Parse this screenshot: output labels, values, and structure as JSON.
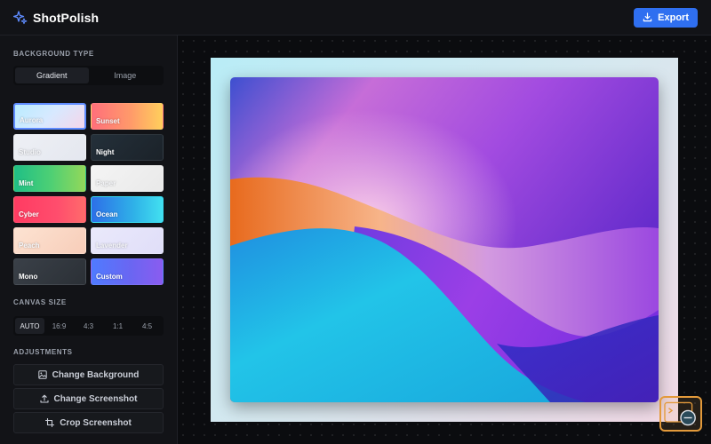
{
  "header": {
    "app_name": "ShotPolish",
    "export_label": "Export"
  },
  "sidebar": {
    "background_type_label": "BACKGROUND TYPE",
    "background_types": [
      {
        "label": "Gradient",
        "active": true
      },
      {
        "label": "Image",
        "active": false
      }
    ],
    "presets": [
      {
        "label": "Aurora",
        "selected": true
      },
      {
        "label": "Sunset",
        "selected": false
      },
      {
        "label": "Studio",
        "selected": false
      },
      {
        "label": "Night",
        "selected": false
      },
      {
        "label": "Mint",
        "selected": false
      },
      {
        "label": "Paper",
        "selected": false
      },
      {
        "label": "Cyber",
        "selected": false
      },
      {
        "label": "Ocean",
        "selected": false
      },
      {
        "label": "Peach",
        "selected": false
      },
      {
        "label": "Lavender",
        "selected": false
      },
      {
        "label": "Mono",
        "selected": false
      },
      {
        "label": "Custom",
        "selected": false
      }
    ],
    "canvas_size_label": "CANVAS SIZE",
    "canvas_sizes": [
      {
        "label": "AUTO",
        "active": true
      },
      {
        "label": "16:9",
        "active": false
      },
      {
        "label": "4:3",
        "active": false
      },
      {
        "label": "1:1",
        "active": false
      },
      {
        "label": "4:5",
        "active": false
      }
    ],
    "adjustments_label": "ADJUSTMENTS",
    "adjustments": [
      {
        "label": "Change Background",
        "icon": "image-icon"
      },
      {
        "label": "Change Screenshot",
        "icon": "upload-icon"
      },
      {
        "label": "Crop Screenshot",
        "icon": "crop-icon"
      }
    ]
  },
  "colors": {
    "accent": "#2f6ff0",
    "selected_border": "#5f8cff"
  }
}
